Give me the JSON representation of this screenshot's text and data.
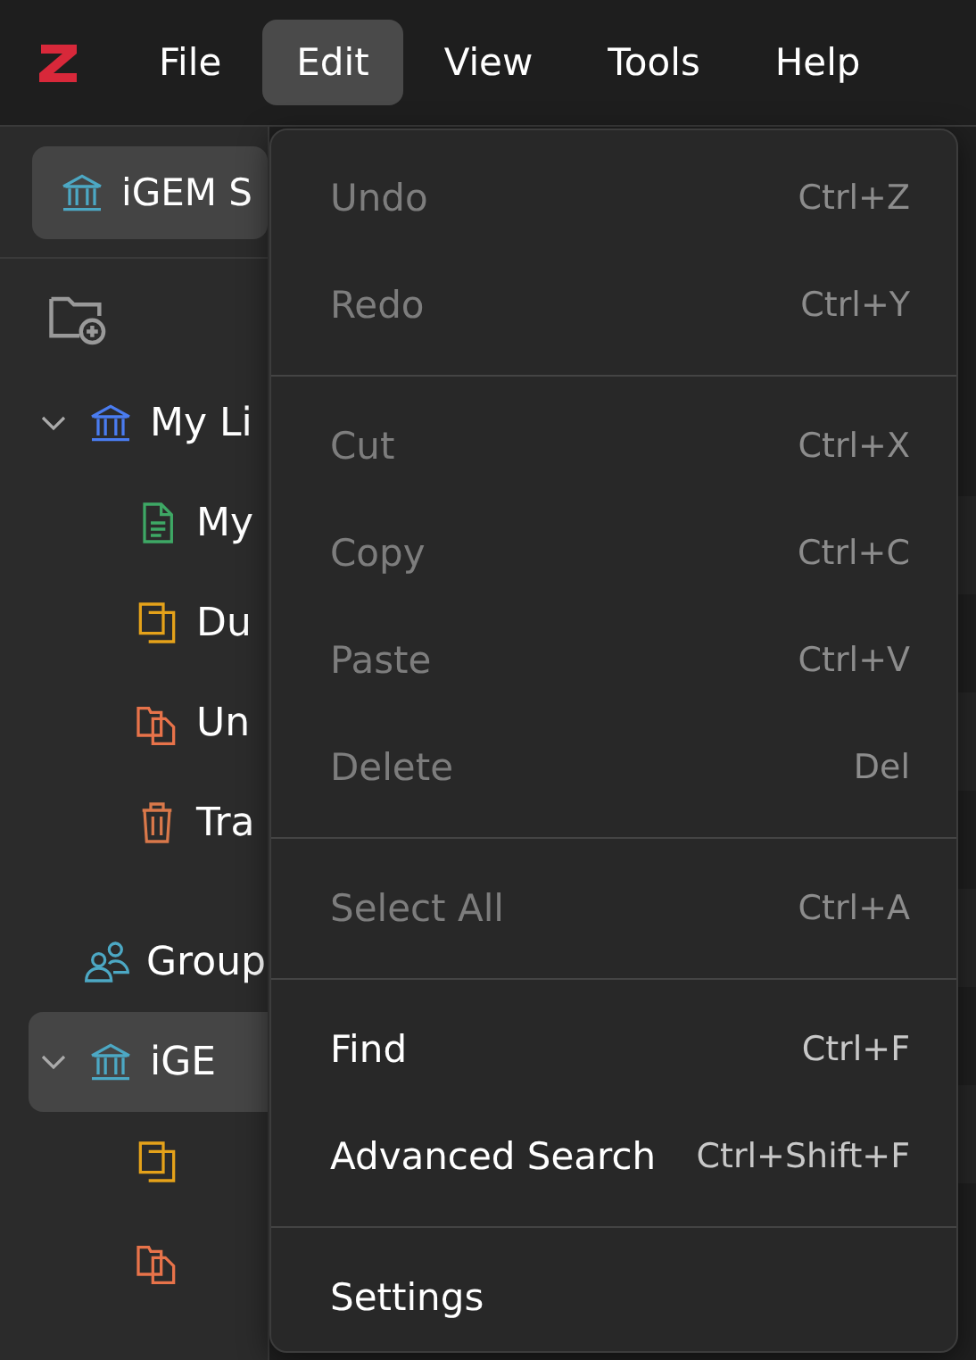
{
  "menubar": {
    "items": [
      {
        "label": "File",
        "selected": false
      },
      {
        "label": "Edit",
        "selected": true
      },
      {
        "label": "View",
        "selected": false
      },
      {
        "label": "Tools",
        "selected": false
      },
      {
        "label": "Help",
        "selected": false
      }
    ]
  },
  "library_selector": {
    "label": "iGEM S"
  },
  "sidebar": {
    "items": [
      {
        "label": "My Li",
        "kind": "library",
        "expanded": true,
        "selected": false,
        "children": [
          {
            "label": "My",
            "kind": "note",
            "selected": false
          },
          {
            "label": "Du",
            "kind": "duplicates",
            "selected": false
          },
          {
            "label": "Un",
            "kind": "unfiled",
            "selected": false
          },
          {
            "label": "Tra",
            "kind": "trash",
            "selected": false
          }
        ]
      },
      {
        "label": "Group",
        "kind": "group",
        "selected": false
      },
      {
        "label": "iGE",
        "kind": "group-library",
        "expanded": true,
        "selected": true,
        "children": [
          {
            "kind": "duplicates",
            "selected": false
          },
          {
            "kind": "unfiled",
            "selected": false
          }
        ]
      }
    ]
  },
  "edit_menu": {
    "groups": [
      [
        {
          "label": "Undo",
          "shortcut": "Ctrl+Z",
          "disabled": true
        },
        {
          "label": "Redo",
          "shortcut": "Ctrl+Y",
          "disabled": true
        }
      ],
      [
        {
          "label": "Cut",
          "shortcut": "Ctrl+X",
          "disabled": true
        },
        {
          "label": "Copy",
          "shortcut": "Ctrl+C",
          "disabled": true
        },
        {
          "label": "Paste",
          "shortcut": "Ctrl+V",
          "disabled": true
        },
        {
          "label": "Delete",
          "shortcut": "Del",
          "disabled": true
        }
      ],
      [
        {
          "label": "Select All",
          "shortcut": "Ctrl+A",
          "disabled": true
        }
      ],
      [
        {
          "label": "Find",
          "shortcut": "Ctrl+F",
          "disabled": false
        },
        {
          "label": "Advanced Search",
          "shortcut": "Ctrl+Shift+F",
          "disabled": false
        }
      ],
      [
        {
          "label": "Settings",
          "disabled": false
        }
      ]
    ]
  }
}
